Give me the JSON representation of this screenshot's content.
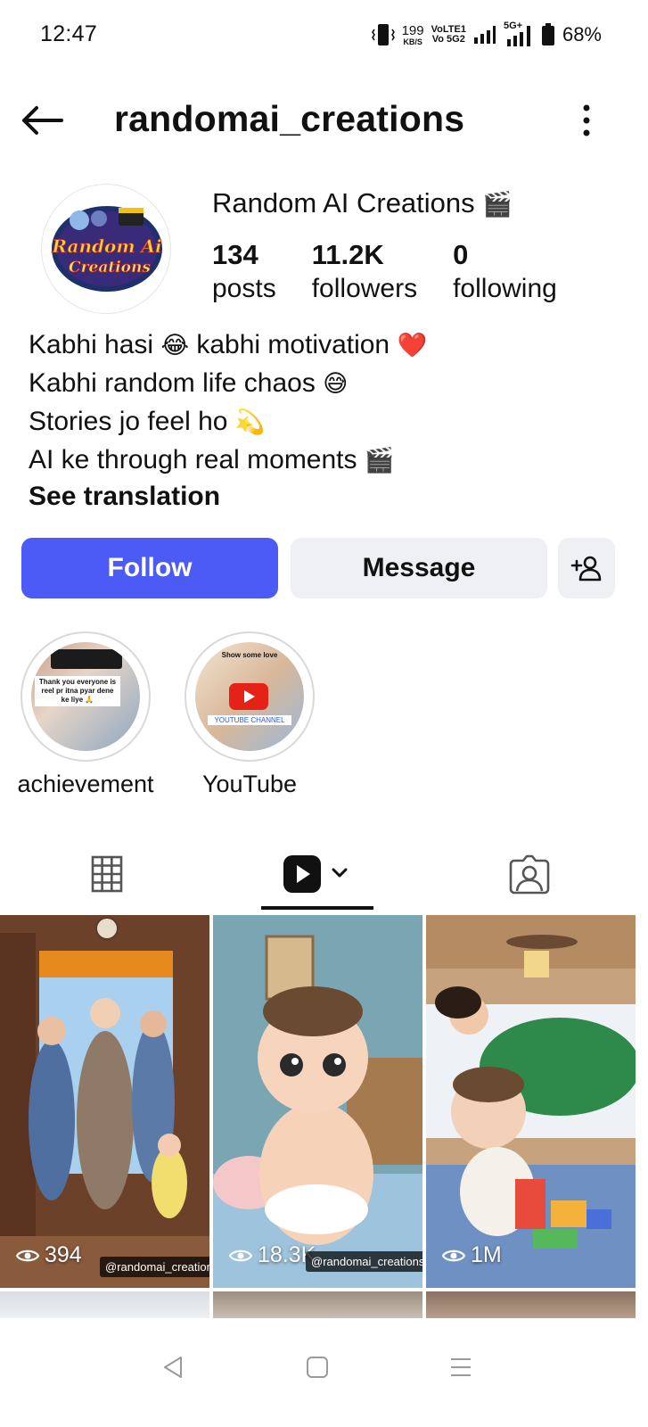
{
  "status_bar": {
    "time": "12:47",
    "net_speed_value": "199",
    "net_speed_unit": "KB/S",
    "volte_1": "VoLTE1",
    "volte_2": "Vo 5G2",
    "network_5g": "5G+",
    "battery": "68%"
  },
  "header": {
    "username": "randomai_creations",
    "back_icon": "arrow-left-icon",
    "more_icon": "vertical-dots-icon"
  },
  "profile": {
    "avatar_text_1": "Random Ai",
    "avatar_text_2": "Creations",
    "display_name": "Random AI Creations",
    "display_name_emoji": "🎬",
    "stats": [
      {
        "value": "134",
        "label": "posts"
      },
      {
        "value": "11.2K",
        "label": "followers"
      },
      {
        "value": "0",
        "label": "following"
      }
    ],
    "bio": [
      {
        "text": "Kabhi hasi ",
        "emoji": "😂",
        "text2": " kabhi motivation ",
        "emoji2": "❤️"
      },
      {
        "text": "Kabhi random life chaos ",
        "emoji": "😅",
        "text2": "",
        "emoji2": ""
      },
      {
        "text": "Stories jo feel ho ",
        "emoji": "💫",
        "text2": "",
        "emoji2": ""
      },
      {
        "text": "AI ke through real moments ",
        "emoji": "🎬",
        "text2": "",
        "emoji2": ""
      }
    ],
    "see_translation": "See translation"
  },
  "actions": {
    "follow": "Follow",
    "message": "Message",
    "add_user_icon": "add-user-icon"
  },
  "highlights": [
    {
      "label": "achievement",
      "cover_text": "Thank you everyone is reel pr itna pyar dene ke liye 🙏"
    },
    {
      "label": "YouTube",
      "cover_title": "Show some love",
      "cover_text": "YOUTUBE CHANNEL"
    }
  ],
  "tabs": {
    "grid_icon": "grid-icon",
    "reels_icon": "reels-icon",
    "tagged_icon": "tagged-icon",
    "active": "reels"
  },
  "posts": [
    {
      "views": "394",
      "watermark": "@randomai_creations"
    },
    {
      "views": "18.3K",
      "watermark": "@randomai_creations"
    },
    {
      "views": "1M",
      "watermark": ""
    }
  ],
  "colors": {
    "follow_bg": "#4c5bf6",
    "secondary_btn_bg": "#eff0f3",
    "text": "#111111"
  },
  "navbar": {
    "back": "nav-back-icon",
    "home": "nav-home-icon",
    "menu": "nav-menu-icon"
  }
}
